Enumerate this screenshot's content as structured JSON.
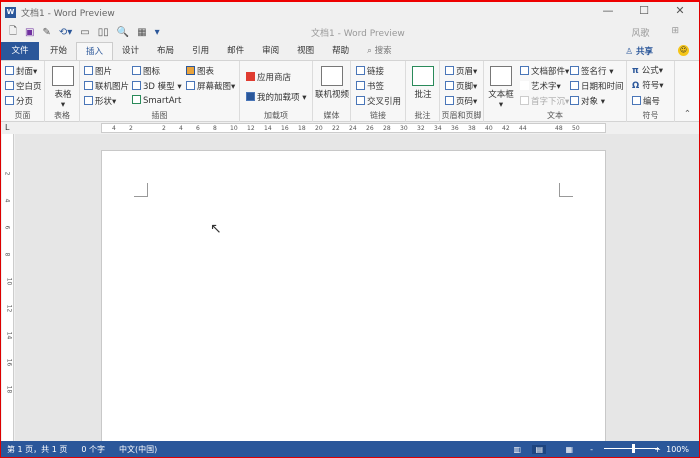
{
  "window": {
    "title": "文档1 - Word Preview",
    "minimize": "—",
    "maximize": "☐",
    "close": "✕"
  },
  "qat": {
    "title": "文档1 - Word Preview",
    "user": "风歌",
    "layout": "⊞"
  },
  "tabs": [
    {
      "label": "文件"
    },
    {
      "label": "开始"
    },
    {
      "label": "插入"
    },
    {
      "label": "设计"
    },
    {
      "label": "布局"
    },
    {
      "label": "引用"
    },
    {
      "label": "邮件"
    },
    {
      "label": "审阅"
    },
    {
      "label": "视图"
    },
    {
      "label": "帮助"
    }
  ],
  "search": {
    "placeholder": "搜索"
  },
  "share": "共享",
  "ribbon": {
    "pages": {
      "label": "页面",
      "items": [
        "封面",
        "空白页",
        "分页"
      ]
    },
    "tables": {
      "label": "表格",
      "table": "表格"
    },
    "illus": {
      "label": "插图",
      "items": [
        "图片",
        "联机图片",
        "形状",
        "图标",
        "3D 模型",
        "SmartArt",
        "图表",
        "屏幕截图"
      ]
    },
    "addins": {
      "label": "加载项",
      "items": [
        "应用商店",
        "我的加载项"
      ]
    },
    "media": {
      "label": "媒体",
      "video": "联机视频"
    },
    "links": {
      "label": "链接",
      "items": [
        "链接",
        "书签",
        "交叉引用"
      ]
    },
    "comments": {
      "label": "批注",
      "comment": "批注"
    },
    "hf": {
      "label": "页眉和页脚",
      "items": [
        "页眉",
        "页脚",
        "页码"
      ]
    },
    "text": {
      "label": "文本",
      "textbox": "文本框",
      "items": [
        "文档部件",
        "艺术字",
        "首字下沉",
        "签名行",
        "日期和时间",
        "对象"
      ]
    },
    "symbols": {
      "label": "符号",
      "items": [
        "公式",
        "符号",
        "编号"
      ]
    }
  },
  "ruler": {
    "h": [
      "4",
      "2",
      "2",
      "4",
      "6",
      "8",
      "10",
      "12",
      "14",
      "16",
      "18",
      "20",
      "22",
      "24",
      "26",
      "28",
      "30",
      "32",
      "34",
      "36",
      "38",
      "40",
      "42",
      "44",
      "48",
      "50"
    ],
    "v": [
      "2",
      "4",
      "6",
      "8",
      "10",
      "12",
      "14",
      "16",
      "18"
    ]
  },
  "status": {
    "page": "第 1 页，共 1 页",
    "words": "0 个字",
    "lang": "中文(中国)",
    "zoom": "100%"
  }
}
